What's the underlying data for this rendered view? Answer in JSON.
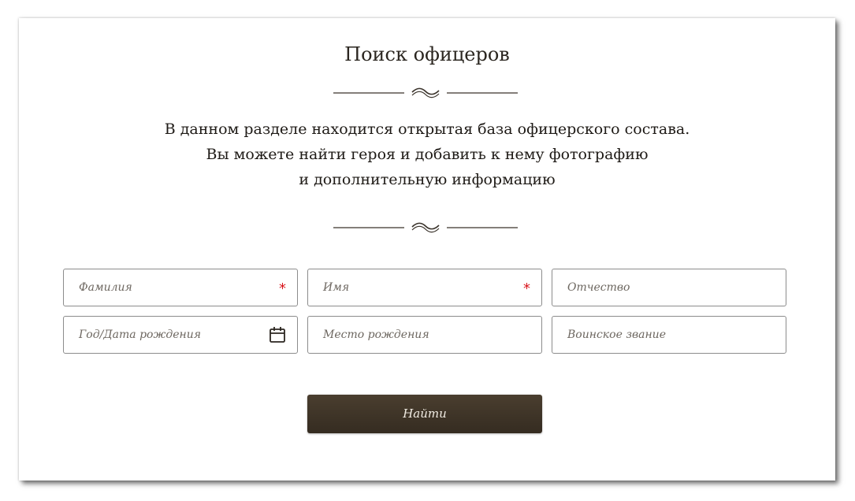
{
  "page": {
    "title": "Поиск офицеров",
    "intro_lines": [
      "В данном разделе находится открытая база офицерского состава.",
      "Вы можете найти героя и добавить к нему фотографию",
      "и дополнительную информацию"
    ]
  },
  "form": {
    "fields": [
      {
        "placeholder": "Фамилия",
        "required": true
      },
      {
        "placeholder": "Имя",
        "required": true
      },
      {
        "placeholder": "Отчество",
        "required": false
      },
      {
        "placeholder": "Год/Дата рождения",
        "icon": "calendar-icon"
      },
      {
        "placeholder": "Место рождения"
      },
      {
        "placeholder": "Воинское звание"
      }
    ],
    "required_mark": "*",
    "submit_label": "Найти"
  },
  "colors": {
    "button_bg": "#3e3427",
    "required": "#d8141b",
    "text": "#2b2620"
  }
}
